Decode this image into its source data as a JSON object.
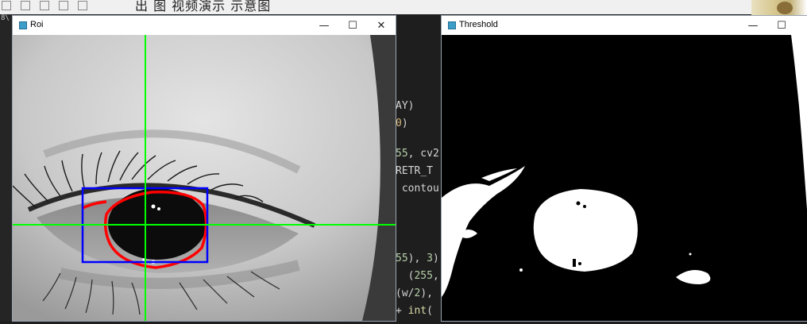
{
  "top_bar": {
    "text": "出 图 视频演示 示意图"
  },
  "editor": {
    "left_label": "8\\",
    "code_lines": [
      {
        "parts": [
          [
            "",
            "AY)"
          ]
        ]
      },
      {
        "parts": [
          [
            "y",
            "0"
          ],
          [
            "",
            ")"
          ]
        ]
      },
      {
        "parts": [
          [
            "n",
            "55"
          ],
          [
            "",
            ", cv2"
          ]
        ]
      },
      {
        "parts": [
          [
            "",
            "RETR_T"
          ]
        ]
      },
      {
        "parts": [
          [
            "",
            " contou"
          ]
        ]
      },
      {
        "parts": [
          [
            "n",
            "55"
          ],
          [
            "",
            "), "
          ],
          [
            "n",
            "3"
          ],
          [
            "",
            ")"
          ]
        ]
      },
      {
        "parts": [
          [
            "",
            "  ("
          ],
          [
            "n",
            "255"
          ],
          [
            "",
            ","
          ]
        ]
      },
      {
        "parts": [
          [
            "",
            "(w/"
          ],
          [
            "n",
            "2"
          ],
          [
            "",
            "),"
          ]
        ]
      },
      {
        "parts": [
          [
            "",
            "+ "
          ],
          [
            "f",
            "int"
          ],
          [
            "",
            "("
          ]
        ]
      }
    ]
  },
  "roi_window": {
    "title": "Roi",
    "minimize": "—",
    "maximize": "☐",
    "close": "✕",
    "overlay_colors": {
      "crosshair": "#00ff00",
      "box": "#0000ff",
      "contour": "#ff0000"
    }
  },
  "threshold_window": {
    "title": "Threshold",
    "minimize": "—",
    "maximize": "☐"
  }
}
